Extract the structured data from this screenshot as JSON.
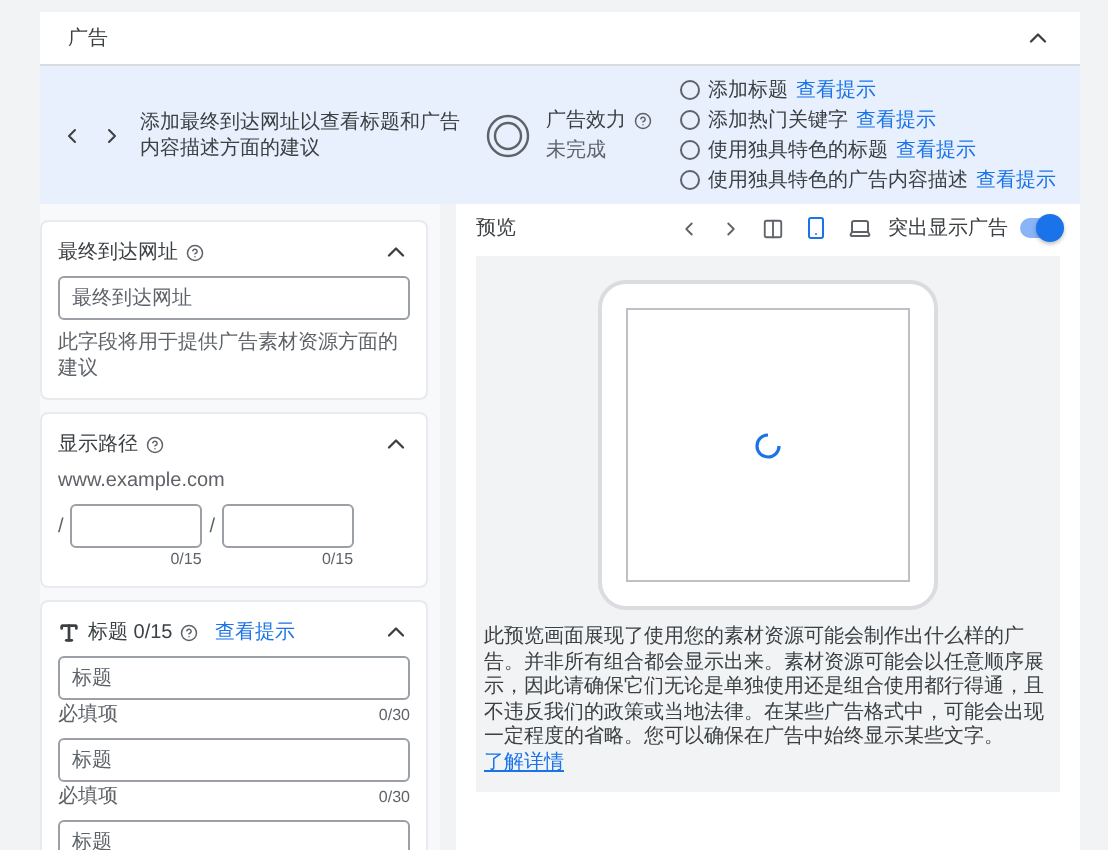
{
  "section": {
    "title": "广告",
    "expanded": true
  },
  "suggestions": {
    "message": "添加最终到达网址以查看标题和广告内容描述方面的建议",
    "strength_label": "广告效力",
    "strength_status": "未完成",
    "items": [
      {
        "text": "添加标题",
        "link": "查看提示",
        "checked": false
      },
      {
        "text": "添加热门关键字",
        "link": "查看提示",
        "checked": false
      },
      {
        "text": "使用独具特色的标题",
        "link": "查看提示",
        "checked": false
      },
      {
        "text": "使用独具特色的广告内容描述",
        "link": "查看提示",
        "checked": false
      }
    ]
  },
  "url_card": {
    "title": "最终到达网址",
    "expanded": true,
    "placeholder": "最终到达网址",
    "helper": "此字段将用于提供广告素材资源方面的建议"
  },
  "path_card": {
    "title": "显示路径",
    "expanded": true,
    "domain": "www.example.com",
    "paths": [
      {
        "separator": "/",
        "counter": "0/15"
      },
      {
        "separator": "/",
        "counter": "0/15"
      }
    ]
  },
  "headlines_card": {
    "title": "标题 0/15",
    "link": "查看提示",
    "expanded": true,
    "fields": [
      {
        "placeholder": "标题",
        "helper": "必填项",
        "counter": "0/30"
      },
      {
        "placeholder": "标题",
        "helper": "必填项",
        "counter": "0/30"
      },
      {
        "placeholder": "标题"
      }
    ]
  },
  "preview": {
    "title": "预览",
    "devices": [
      {
        "kind": "mobile",
        "selected": true
      },
      {
        "kind": "desktop",
        "selected": false
      }
    ],
    "toggle": {
      "label": "突出显示广告",
      "on": true
    },
    "disclaimer": "此预览画面展现了使用您的素材资源可能会制作出什么样的广告。并非所有组合都会显示出来。素材资源可能会以任意顺序展示，因此请确保它们无论是单独使用还是组合使用都行得通，且不违反我们的政策或当地法律。在某些广告格式中，可能会出现一定程度的省略。您可以确保在广告中始终显示某些文字。",
    "link": "了解详情"
  }
}
